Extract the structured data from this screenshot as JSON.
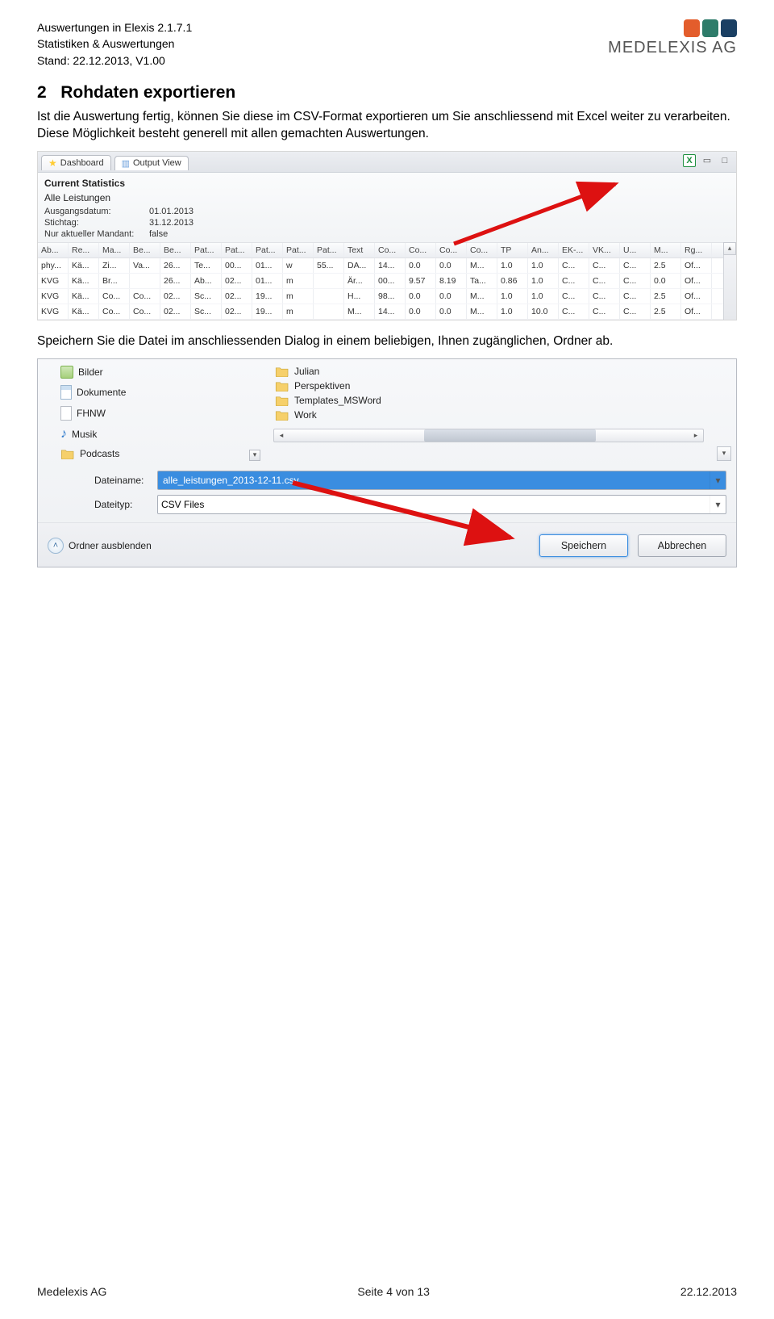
{
  "header": {
    "title": "Auswertungen in Elexis 2.1.7.1",
    "subtitle": "Statistiken & Auswertungen",
    "stand": "Stand: 22.12.2013, V1.00",
    "logo_text": "MEDELEXIS AG"
  },
  "section": {
    "number": "2",
    "heading": "Rohdaten exportieren",
    "para1": "Ist die Auswertung fertig, können Sie diese im CSV-Format exportieren um Sie anschliessend mit Excel weiter zu verarbeiten. Diese Möglichkeit besteht generell mit allen gemachten Auswertungen.",
    "para2": "Speichern Sie die Datei im anschliessenden Dialog in einem beliebigen, Ihnen zugänglichen, Ordner ab."
  },
  "stats_view": {
    "tabs": {
      "dashboard": "Dashboard",
      "output": "Output View"
    },
    "panel_title": "Current Statistics",
    "subtitle": "Alle Leistungen",
    "rows": {
      "ausgangsdatum_label": "Ausgangsdatum:",
      "ausgangsdatum_value": "01.01.2013",
      "stichtag_label": "Stichtag:",
      "stichtag_value": "31.12.2013",
      "mandant_label": "Nur aktueller Mandant:",
      "mandant_value": "false"
    },
    "columns": [
      "Ab...",
      "Re...",
      "Ma...",
      "Be...",
      "Be...",
      "Pat...",
      "Pat...",
      "Pat...",
      "Pat...",
      "Pat...",
      "Text",
      "Co...",
      "Co...",
      "Co...",
      "Co...",
      "TP",
      "An...",
      "EK-...",
      "VK...",
      "U...",
      "M...",
      "Rg..."
    ],
    "data": [
      [
        "phy...",
        "Kä...",
        "Zi...",
        "Va...",
        "26...",
        "Te...",
        "00...",
        "01...",
        "w",
        "55...",
        "DA...",
        "14...",
        "0.0",
        "0.0",
        "M...",
        "1.0",
        "1.0",
        "C...",
        "C...",
        "C...",
        "2.5",
        "Of..."
      ],
      [
        "KVG",
        "Kä...",
        "Br...",
        "",
        "26...",
        "Ab...",
        "02...",
        "01...",
        "m",
        "",
        "Är...",
        "00...",
        "9.57",
        "8.19",
        "Ta...",
        "0.86",
        "1.0",
        "C...",
        "C...",
        "C...",
        "0.0",
        "Of..."
      ],
      [
        "KVG",
        "Kä...",
        "Co...",
        "Co...",
        "02...",
        "Sc...",
        "02...",
        "19...",
        "m",
        "",
        "H...",
        "98...",
        "0.0",
        "0.0",
        "M...",
        "1.0",
        "1.0",
        "C...",
        "C...",
        "C...",
        "2.5",
        "Of..."
      ],
      [
        "KVG",
        "Kä...",
        "Co...",
        "Co...",
        "02...",
        "Sc...",
        "02...",
        "19...",
        "m",
        "",
        "M...",
        "14...",
        "0.0",
        "0.0",
        "M...",
        "1.0",
        "10.0",
        "C...",
        "C...",
        "C...",
        "2.5",
        "Of..."
      ]
    ]
  },
  "save_dialog": {
    "left_items": [
      {
        "icon": "pic",
        "label": "Bilder"
      },
      {
        "icon": "doc",
        "label": "Dokumente"
      },
      {
        "icon": "fhnw",
        "label": "FHNW"
      },
      {
        "icon": "music",
        "label": "Musik"
      },
      {
        "icon": "pod",
        "label": "Podcasts"
      }
    ],
    "right_items": [
      {
        "label": "Julian"
      },
      {
        "label": "Perspektiven"
      },
      {
        "label": "Templates_MSWord"
      },
      {
        "label": "Work"
      }
    ],
    "filename_label": "Dateiname:",
    "filename_value": "alle_leistungen_2013-12-11.csv",
    "filetype_label": "Dateityp:",
    "filetype_value": "CSV Files",
    "hide_folder": "Ordner ausblenden",
    "save_btn": "Speichern",
    "cancel_btn": "Abbrechen"
  },
  "footer": {
    "left": "Medelexis AG",
    "center": "Seite 4 von 13",
    "right": "22.12.2013"
  }
}
